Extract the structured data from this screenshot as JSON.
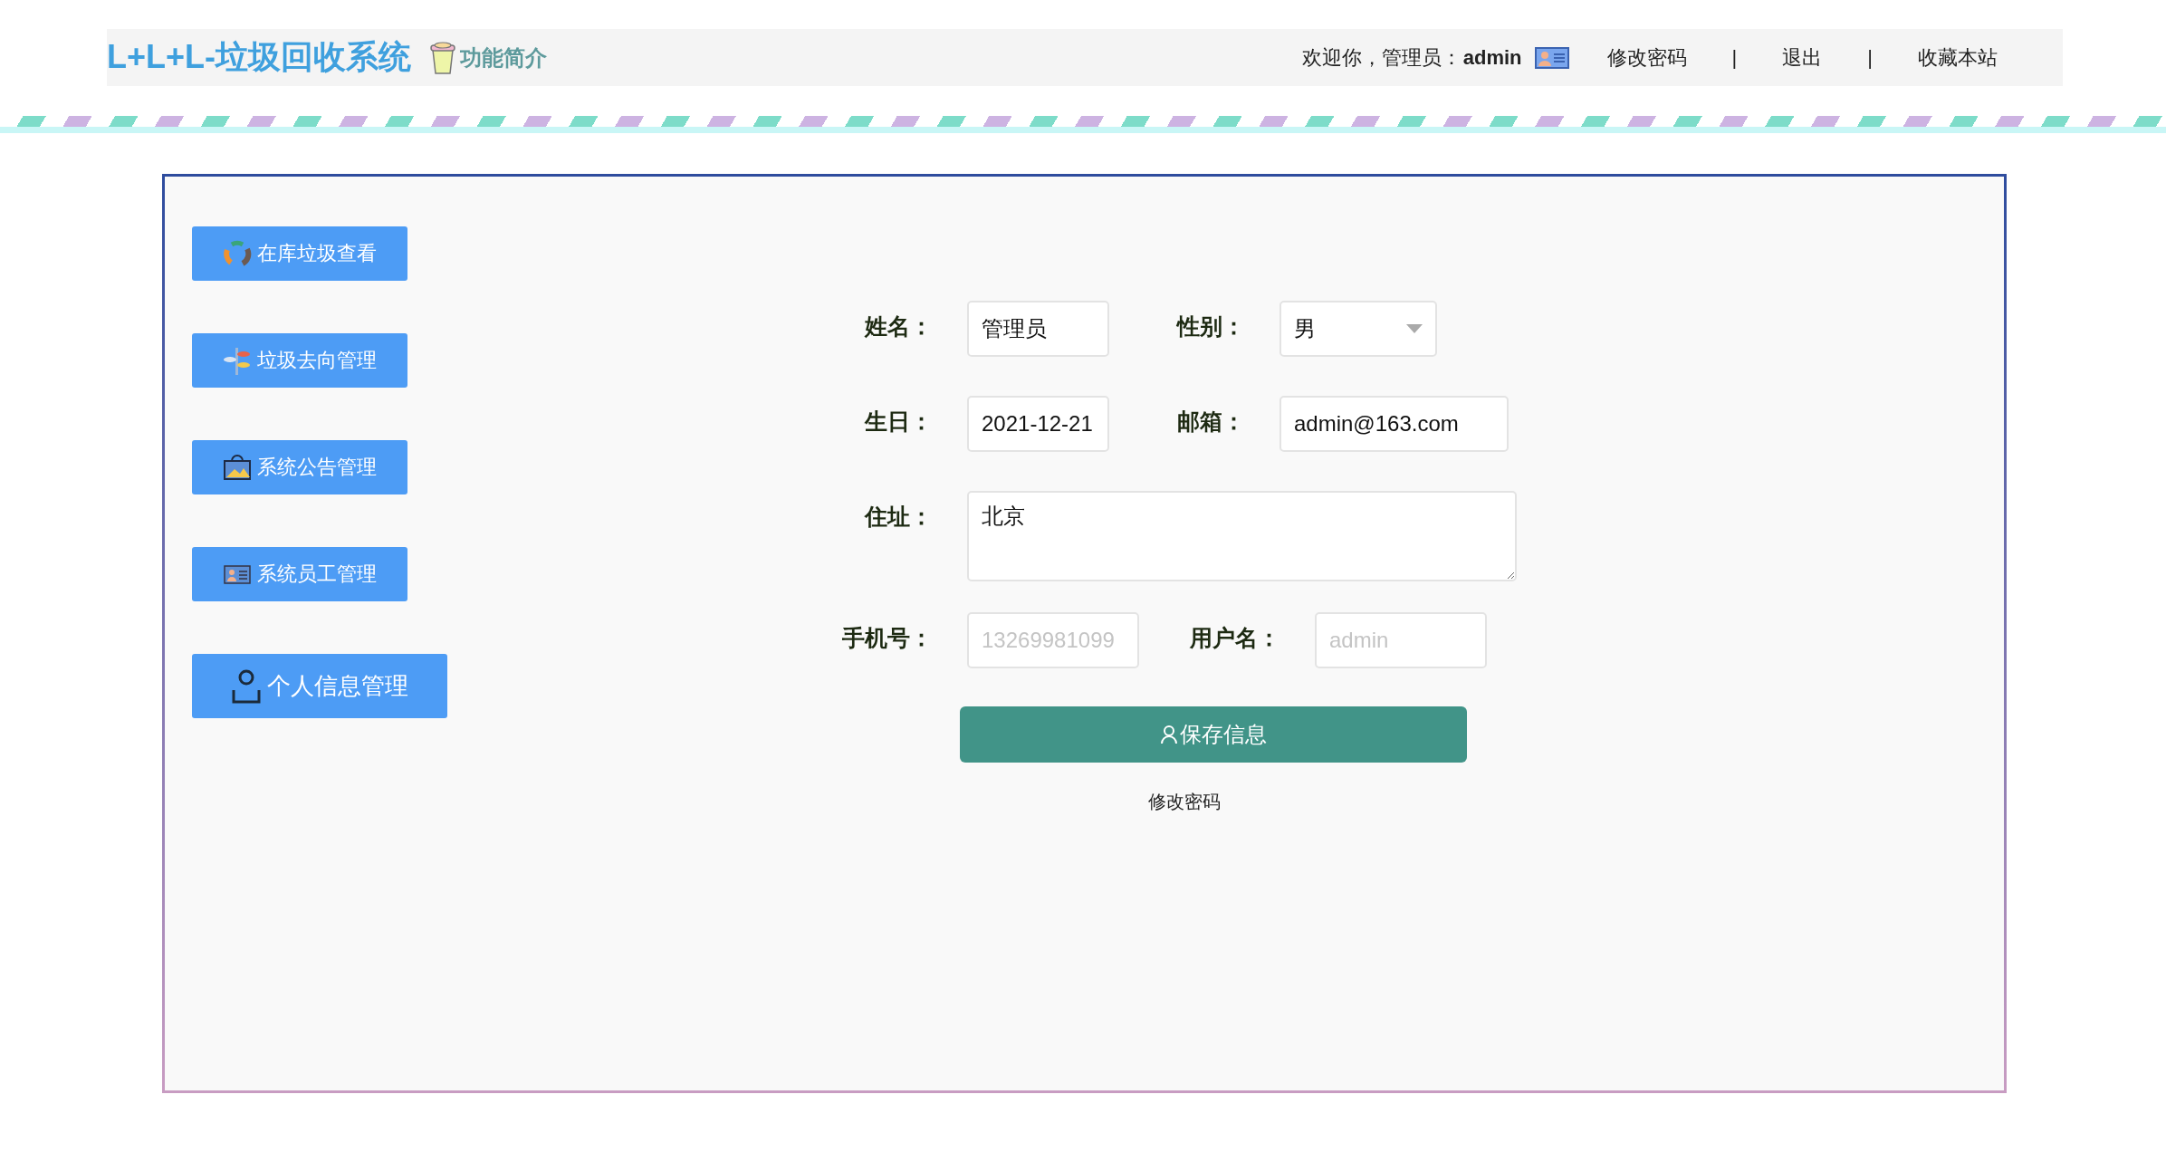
{
  "header": {
    "title": "L+L+L-垃圾回收系统",
    "intro_link": "功能简介",
    "welcome": "欢迎你，管理员：",
    "user": "admin",
    "nav": [
      {
        "kind": "link",
        "text": "修改密码"
      },
      {
        "kind": "separator",
        "text": "|"
      },
      {
        "kind": "link",
        "text": "退出"
      },
      {
        "kind": "separator",
        "text": "|"
      },
      {
        "kind": "link",
        "text": "收藏本站"
      }
    ]
  },
  "sidebar": {
    "items": [
      {
        "label": "在库垃圾查看",
        "selected": false
      },
      {
        "label": "垃圾去向管理",
        "selected": false
      },
      {
        "label": "系统公告管理",
        "selected": false
      },
      {
        "label": "系统员工管理",
        "selected": false
      },
      {
        "label": "个人信息管理",
        "selected": true
      }
    ]
  },
  "form": {
    "rows": [
      [
        {
          "label": "姓名：",
          "kind": "text",
          "value": "管理员"
        },
        {
          "label": "性别：",
          "kind": "select",
          "value": "男"
        }
      ],
      [
        {
          "label": "生日：",
          "kind": "text",
          "value": "2021-12-21"
        },
        {
          "label": "邮箱：",
          "kind": "text",
          "value": "admin@163.com"
        }
      ],
      [
        {
          "label": "住址：",
          "kind": "textarea",
          "value": "北京"
        }
      ],
      [
        {
          "label": "手机号：",
          "kind": "text",
          "placeholder": "13269981099"
        },
        {
          "label": "用户名：",
          "kind": "text",
          "placeholder": "admin"
        }
      ]
    ],
    "save_button": "保存信息",
    "change_password_link": "修改密码"
  }
}
